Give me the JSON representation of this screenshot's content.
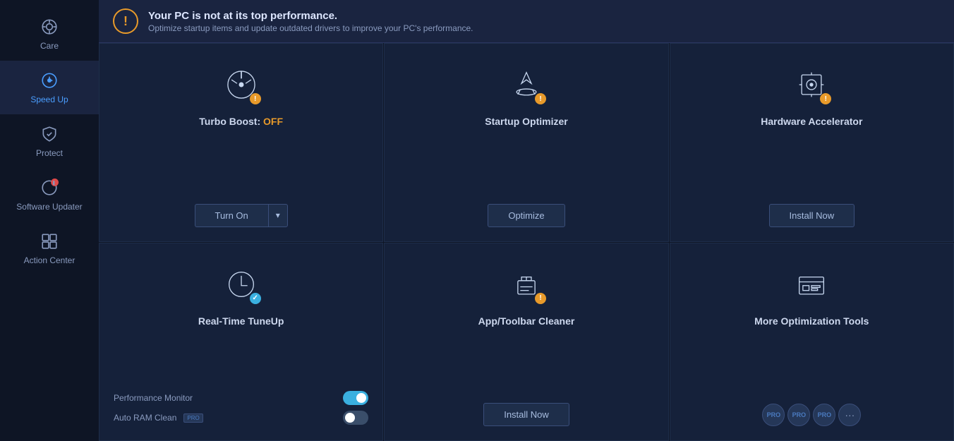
{
  "sidebar": {
    "items": [
      {
        "id": "care",
        "label": "Care",
        "active": false
      },
      {
        "id": "speed-up",
        "label": "Speed Up",
        "active": true
      },
      {
        "id": "protect",
        "label": "Protect",
        "active": false
      },
      {
        "id": "software-updater",
        "label": "Software Updater",
        "active": false
      },
      {
        "id": "action-center",
        "label": "Action Center",
        "active": false
      }
    ]
  },
  "header": {
    "title": "Your PC is not at its top performance.",
    "subtitle": "Optimize startup items and update outdated drivers to improve your PC's performance.",
    "icon": "!"
  },
  "cards": [
    {
      "id": "turbo-boost",
      "title": "Turbo Boost:",
      "status": "OFF",
      "badge_type": "warning",
      "button_type": "split",
      "button_label": "Turn On",
      "button_arrow": "▾"
    },
    {
      "id": "startup-optimizer",
      "title": "Startup Optimizer",
      "status": null,
      "badge_type": "warning",
      "button_type": "normal",
      "button_label": "Optimize"
    },
    {
      "id": "hardware-accelerator",
      "title": "Hardware Accelerator",
      "status": null,
      "badge_type": "warning",
      "button_type": "normal",
      "button_label": "Install Now"
    },
    {
      "id": "real-time-tuneup",
      "title": "Real-Time TuneUp",
      "status": null,
      "badge_type": "check",
      "button_type": "perf",
      "perf_items": [
        {
          "label": "Performance Monitor",
          "toggle": "on"
        },
        {
          "label": "Auto RAM Clean",
          "toggle": "off",
          "pro": true
        }
      ]
    },
    {
      "id": "app-toolbar-cleaner",
      "title": "App/Toolbar Cleaner",
      "status": null,
      "badge_type": "warning",
      "button_type": "normal",
      "button_label": "Install Now"
    },
    {
      "id": "more-optimization",
      "title": "More Optimization Tools",
      "status": null,
      "badge_type": null,
      "button_type": "pro-icons"
    }
  ],
  "pro_badges": [
    "PRO",
    "PRO",
    "PRO"
  ],
  "colors": {
    "warning": "#e89a2a",
    "check": "#3ab0e0",
    "accent": "#4a9eff"
  }
}
